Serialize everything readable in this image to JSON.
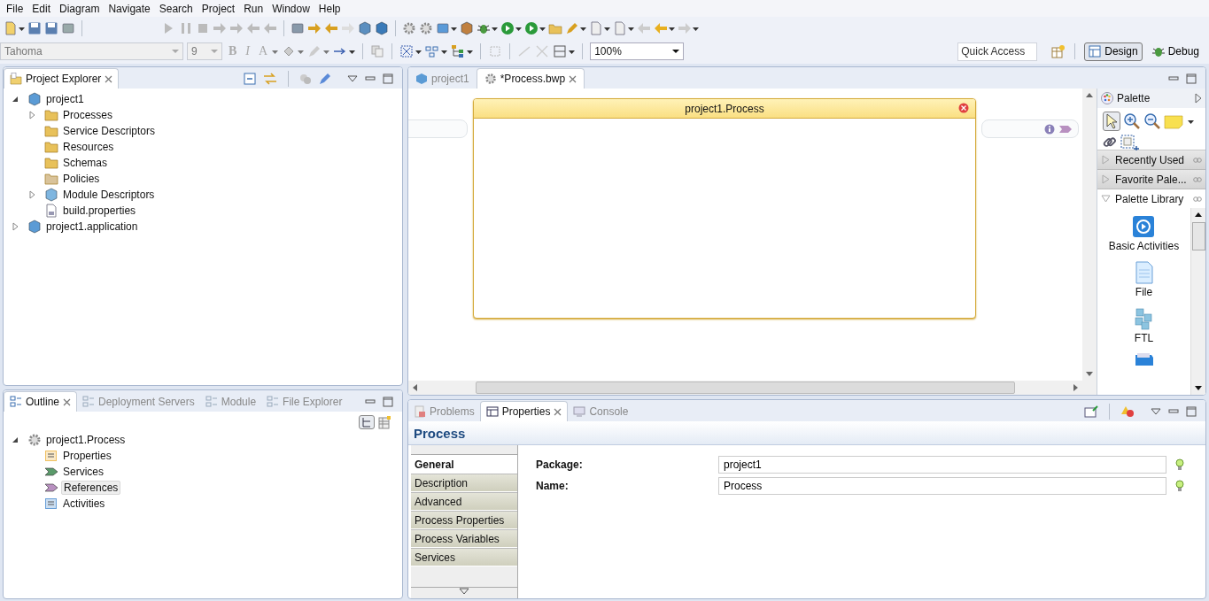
{
  "menu": [
    "File",
    "Edit",
    "Diagram",
    "Navigate",
    "Search",
    "Project",
    "Run",
    "Window",
    "Help"
  ],
  "format_bar": {
    "font": "Tahoma",
    "size": "9",
    "style_buttons": [
      "B",
      "I",
      "A"
    ],
    "zoom": "100%"
  },
  "quick_access": {
    "placeholder": "Quick Access"
  },
  "perspectives": [
    {
      "label": "Design",
      "selected": true
    },
    {
      "label": "Debug",
      "selected": false
    }
  ],
  "project_explorer": {
    "tabs": [
      {
        "label": "Project Explorer",
        "selected": true
      }
    ],
    "tree": [
      {
        "label": "project1",
        "expanded": true,
        "children": [
          {
            "label": "Processes",
            "expanded": false
          },
          {
            "label": "Service Descriptors"
          },
          {
            "label": "Resources"
          },
          {
            "label": "Schemas"
          },
          {
            "label": "Policies"
          },
          {
            "label": "Module Descriptors",
            "expanded": false
          },
          {
            "label": "build.properties"
          }
        ]
      },
      {
        "label": "project1.application",
        "expanded": false
      }
    ]
  },
  "outline": {
    "tabs": [
      {
        "label": "Outline",
        "selected": true
      },
      {
        "label": "Deployment Servers",
        "selected": false
      },
      {
        "label": "Module",
        "selected": false
      },
      {
        "label": "File Explorer",
        "selected": false
      }
    ],
    "tree": [
      {
        "label": "project1.Process",
        "expanded": true,
        "selected": false,
        "children": [
          {
            "label": "Properties",
            "selected": false
          },
          {
            "label": "Services",
            "selected": false
          },
          {
            "label": "References",
            "selected": true
          },
          {
            "label": "Activities",
            "selected": false
          }
        ]
      }
    ]
  },
  "editor": {
    "tabs": [
      {
        "label": "project1",
        "selected": false
      },
      {
        "label": "*Process.bwp",
        "selected": true
      }
    ],
    "process_title": "project1.Process"
  },
  "palette": {
    "title": "Palette",
    "drawers": [
      {
        "label": "Recently Used",
        "expanded": false
      },
      {
        "label": "Favorite Pale...",
        "expanded": false
      },
      {
        "label": "Palette Library",
        "expanded": true
      }
    ],
    "items": [
      "Basic Activities",
      "File",
      "FTL"
    ]
  },
  "bottom": {
    "tabs": [
      {
        "label": "Problems",
        "selected": false
      },
      {
        "label": "Properties",
        "selected": true
      },
      {
        "label": "Console",
        "selected": false
      }
    ],
    "title": "Process",
    "sections": [
      {
        "label": "General",
        "selected": true
      },
      {
        "label": "Description",
        "selected": false
      },
      {
        "label": "Advanced",
        "selected": false
      },
      {
        "label": "Process Properties",
        "selected": false
      },
      {
        "label": "Process Variables",
        "selected": false
      },
      {
        "label": "Services",
        "selected": false
      }
    ],
    "fields": [
      {
        "label": "Package:",
        "value": "project1"
      },
      {
        "label": "Name:",
        "value": "Process"
      }
    ]
  }
}
